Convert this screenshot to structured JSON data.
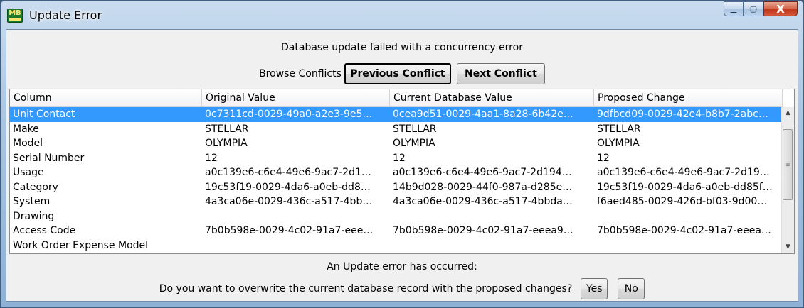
{
  "window": {
    "title": "Update Error",
    "app_icon_text": "MB"
  },
  "caption": {
    "minimize": "▁",
    "maximize": "▢",
    "close": "X"
  },
  "header_message": "Database update failed with a concurrency error",
  "browse": {
    "label": "Browse Conflicts",
    "previous": "Previous Conflict",
    "next": "Next Conflict"
  },
  "grid": {
    "columns": [
      "Column",
      "Original Value",
      "Current Database Value",
      "Proposed Change"
    ],
    "rows": [
      [
        "Unit Contact",
        "0c7311cd-0029-49a0-a2e3-9e5…",
        "0cea9d51-0029-4aa1-8a28-6b42e…",
        "9dfbcd09-0029-42e4-b8b7-2abc…"
      ],
      [
        "Make",
        "STELLAR",
        "STELLAR",
        "STELLAR"
      ],
      [
        "Model",
        "OLYMPIA",
        "OLYMPIA",
        "OLYMPIA"
      ],
      [
        "Serial Number",
        "12",
        "12",
        "12"
      ],
      [
        "Usage",
        "a0c139e6-c6e4-49e6-9ac7-2d1…",
        "a0c139e6-c6e4-49e6-9ac7-2d194…",
        "a0c139e6-c6e4-49e6-9ac7-2d19…"
      ],
      [
        "Category",
        "19c53f19-0029-4da6-a0eb-dd8…",
        "14b9d028-0029-44f0-987a-d285e…",
        "19c53f19-0029-4da6-a0eb-dd85f…"
      ],
      [
        "System",
        "4a3ca06e-0029-436c-a517-4bb…",
        "4a3ca06e-0029-436c-a517-4bbda…",
        "f6aed485-0029-426d-bf03-9d00…"
      ],
      [
        "Drawing",
        "",
        "",
        ""
      ],
      [
        "Access Code",
        "7b0b598e-0029-4c02-91a7-eee…",
        "7b0b598e-0029-4c02-91a7-eeea9…",
        "7b0b598e-0029-4c02-91a7-eeea…"
      ],
      [
        "Work Order Expense Model",
        "",
        "",
        ""
      ]
    ],
    "selected_row": 0
  },
  "footer": {
    "message": "An Update error has occurred:",
    "question": "Do you want to overwrite the current database record with the proposed changes?",
    "yes": "Yes",
    "no": "No"
  },
  "colors": {
    "selection": "#3399ff",
    "close_button": "#c2381a"
  },
  "icons": [
    "app-icon",
    "minimize-icon",
    "maximize-icon",
    "close-icon",
    "scroll-up-arrow-icon",
    "scroll-down-arrow-icon",
    "scroll-grip-icon"
  ]
}
